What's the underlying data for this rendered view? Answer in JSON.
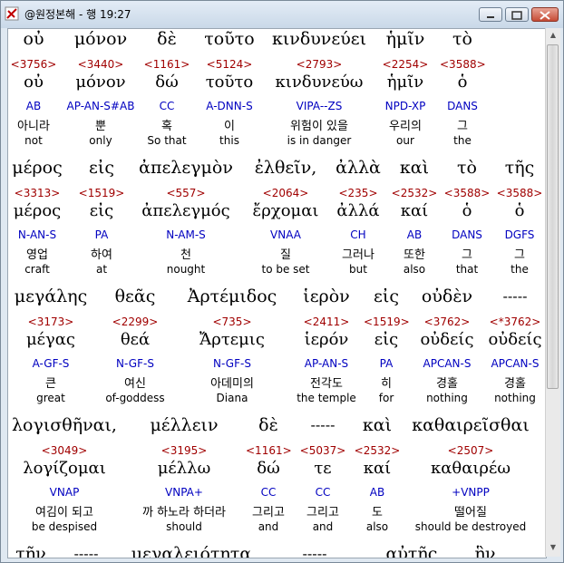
{
  "window": {
    "title": "@원정본해 - 행 19:27"
  },
  "rows": [
    {
      "words": [
        {
          "greek": "οὐ",
          "strong": "<3756>",
          "lemma": "οὐ",
          "parsing": "AB",
          "korean": "아니라",
          "english": "not"
        },
        {
          "greek": "μόνον",
          "strong": "<3440>",
          "lemma": "μόνον",
          "parsing": "AP-AN-S#AB",
          "korean": "뿐",
          "english": "only"
        },
        {
          "greek": "δὲ",
          "strong": "<1161>",
          "lemma": "δώ",
          "parsing": "CC",
          "korean": "혹",
          "english": "So that"
        },
        {
          "greek": "τοῦτο",
          "strong": "<5124>",
          "lemma": "τοῦτο",
          "parsing": "A-DNN-S",
          "korean": "이",
          "english": "this"
        },
        {
          "greek": "κινδυνεύει",
          "strong": "<2793>",
          "lemma": "κινδυνεύω",
          "parsing": "VIPA--ZS",
          "korean": "위험이 있을",
          "english": "is in danger"
        },
        {
          "greek": "ἡμῖν",
          "strong": "<2254>",
          "lemma": "ἡμῖν",
          "parsing": "NPD-XP",
          "korean": "우리의",
          "english": "our"
        },
        {
          "greek": "τὸ",
          "strong": "<3588>",
          "lemma": "ὁ",
          "parsing": "DANS",
          "korean": "그",
          "english": "the"
        }
      ]
    },
    {
      "words": [
        {
          "greek": "μέρος",
          "strong": "<3313>",
          "lemma": "μέρος",
          "parsing": "N-AN-S",
          "korean": "영업",
          "english": "craft"
        },
        {
          "greek": "εἰς",
          "strong": "<1519>",
          "lemma": "εἰς",
          "parsing": "PA",
          "korean": "하여",
          "english": "at"
        },
        {
          "greek": "ἀπελεγμὸν",
          "strong": "<557>",
          "lemma": "ἀπελεγμός",
          "parsing": "N-AM-S",
          "korean": "천",
          "english": "nought"
        },
        {
          "greek": "ἐλθεῖν,",
          "strong": "<2064>",
          "lemma": "ἔρχομαι",
          "parsing": "VNAA",
          "korean": "질",
          "english": "to be set"
        },
        {
          "greek": "ἀλλὰ",
          "strong": "<235>",
          "lemma": "ἀλλά",
          "parsing": "CH",
          "korean": "그러나",
          "english": "but"
        },
        {
          "greek": "καὶ",
          "strong": "<2532>",
          "lemma": "καί",
          "parsing": "AB",
          "korean": "또한",
          "english": "also"
        },
        {
          "greek": "τὸ",
          "strong": "<3588>",
          "lemma": "ὁ",
          "parsing": "DANS",
          "korean": "그",
          "english": "that"
        },
        {
          "greek": "τῆς",
          "strong": "<3588>",
          "lemma": "ὁ",
          "parsing": "DGFS",
          "korean": "그",
          "english": "the"
        }
      ]
    },
    {
      "words": [
        {
          "greek": "μεγάλης",
          "strong": "<3173>",
          "lemma": "μέγας",
          "parsing": "A-GF-S",
          "korean": "큰",
          "english": "great"
        },
        {
          "greek": "θεᾶς",
          "strong": "<2299>",
          "lemma": "θεά",
          "parsing": "N-GF-S",
          "korean": "여신",
          "english": "of-goddess"
        },
        {
          "greek": "Ἀρτέμιδος",
          "strong": "<735>",
          "lemma": "Ἄρτεμις",
          "parsing": "N-GF-S",
          "korean": "아데미의",
          "english": "Diana"
        },
        {
          "greek": "ἱερὸν",
          "strong": "<2411>",
          "lemma": "ἱερόν",
          "parsing": "AP-AN-S",
          "korean": "전각도",
          "english": "the temple"
        },
        {
          "greek": "εἰς",
          "strong": "<1519>",
          "lemma": "εἰς",
          "parsing": "PA",
          "korean": "히",
          "english": "for"
        },
        {
          "greek": "οὐδὲν",
          "strong": "<3762>",
          "lemma": "οὐδείς",
          "parsing": "APCAN-S",
          "korean": "경홀",
          "english": "nothing"
        },
        {
          "greek": "-----",
          "strong": "<*3762>",
          "lemma": "οὐδείς",
          "parsing": "APCAN-S",
          "korean": "경홀",
          "english": "nothing"
        }
      ]
    },
    {
      "words": [
        {
          "greek": "λογισθῆναι,",
          "strong": "<3049>",
          "lemma": "λογίζομαι",
          "parsing": "VNAP",
          "korean": "여김이 되고",
          "english": "be despised"
        },
        {
          "greek": "μέλλειν",
          "strong": "<3195>",
          "lemma": "μέλλω",
          "parsing": "VNPA+",
          "korean": "까 하노라 하더라",
          "english": "should"
        },
        {
          "greek": "δὲ",
          "strong": "<1161>",
          "lemma": "δώ",
          "parsing": "CC",
          "korean": "그리고",
          "english": "and"
        },
        {
          "greek": "-----",
          "strong": "<5037>",
          "lemma": "τε",
          "parsing": "CC",
          "korean": "그리고",
          "english": "and"
        },
        {
          "greek": "καὶ",
          "strong": "<2532>",
          "lemma": "καί",
          "parsing": "AB",
          "korean": "도",
          "english": "also"
        },
        {
          "greek": "καθαιρεῖσθαι",
          "strong": "<2507>",
          "lemma": "καθαιρέω",
          "parsing": "+VNPP",
          "korean": "떨어질",
          "english": "should be destroyed"
        }
      ]
    },
    {
      "words": [
        {
          "greek": "τῆν"
        },
        {
          "greek": "-----"
        },
        {
          "greek": "μεγαλειότητα"
        },
        {
          "greek": "-----"
        },
        {
          "greek": "αὐτῆς"
        },
        {
          "greek": "ἣν"
        }
      ]
    }
  ]
}
